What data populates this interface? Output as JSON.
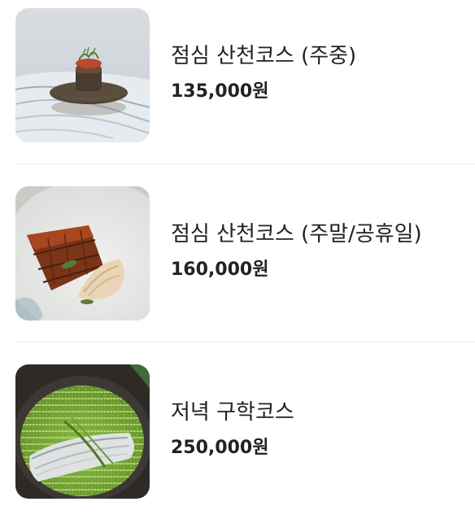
{
  "menu": {
    "items": [
      {
        "title": "점심 산천코스 (주중)",
        "price": "135,000원",
        "image": "plated-appetizer-photo"
      },
      {
        "title": "점심 산천코스 (주말/공휴일)",
        "price": "160,000원",
        "image": "grilled-eel-photo"
      },
      {
        "title": "저녁 구학코스",
        "price": "250,000원",
        "image": "fish-on-green-rice-pot-photo"
      }
    ]
  }
}
